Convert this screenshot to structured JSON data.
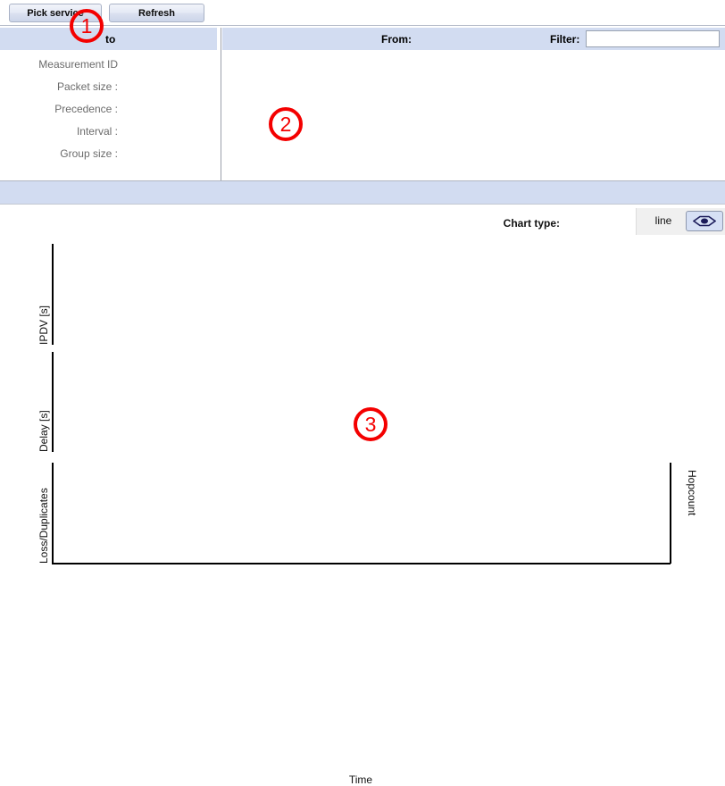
{
  "toolbar": {
    "pick_service_label": "Pick service",
    "refresh_label": "Refresh"
  },
  "info_panel": {
    "left_header_label": "to",
    "right_header_from_label": "From:",
    "filter_label": "Filter:",
    "filter_value": "",
    "filter_placeholder": "",
    "fields": [
      {
        "label": "Measurement ID",
        "value": ""
      },
      {
        "label": "Packet size :",
        "value": ""
      },
      {
        "label": "Precedence :",
        "value": ""
      },
      {
        "label": "Interval :",
        "value": ""
      },
      {
        "label": "Group size :",
        "value": ""
      }
    ]
  },
  "chart_panel": {
    "chart_type_label": "Chart type:",
    "chart_type_value": "line",
    "chart_type_toggle_icon": "diamond-expand-icon"
  },
  "chart_data": {
    "type": "line",
    "title": "",
    "xlabel": "Time",
    "subplots": [
      {
        "ylabel": "IPDV [s]",
        "series": [],
        "x": [],
        "grid": false
      },
      {
        "ylabel": "Delay [s]",
        "series": [],
        "x": [],
        "grid": false
      },
      {
        "ylabel": "Loss/Duplicates",
        "ylabel_right": "Hopcount",
        "series": [],
        "x": [],
        "grid": false
      }
    ],
    "legend": [],
    "annotations": []
  },
  "markers": [
    {
      "id": "1",
      "label": "1"
    },
    {
      "id": "2",
      "label": "2"
    },
    {
      "id": "3",
      "label": "3"
    }
  ],
  "colors": {
    "header_band": "#d2dcf1",
    "marker_red": "#f40000",
    "toggle_active": "#d6e0f5"
  }
}
